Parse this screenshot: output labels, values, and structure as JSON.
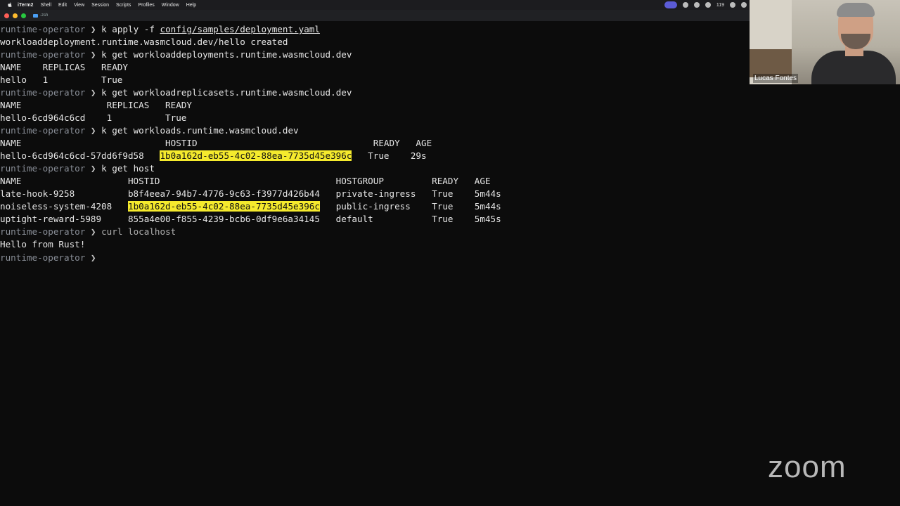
{
  "menubar": {
    "items": [
      "iTerm2",
      "Shell",
      "Edit",
      "View",
      "Session",
      "Scripts",
      "Profiles",
      "Window",
      "Help"
    ],
    "status_number": "119"
  },
  "tab": {
    "label": "-zsh"
  },
  "terminal": {
    "prompt": "runtime-operator",
    "lines": {
      "l1_cmd": "k apply -f ",
      "l1_path": "config/samples/deployment.yaml",
      "l2": "workloaddeployment.runtime.wasmcloud.dev/hello created",
      "l3_cmd": "k get workloaddeployments.runtime.wasmcloud.dev",
      "l4": "NAME    REPLICAS   READY",
      "l5": "hello   1          True",
      "l6_cmd": "k get workloadreplicasets.runtime.wasmcloud.dev",
      "l7": "NAME                REPLICAS   READY",
      "l8": "hello-6cd964c6cd    1          True",
      "l9_cmd": "k get workloads.runtime.wasmcloud.dev",
      "l10": "NAME                           HOSTID                                 READY   AGE",
      "l11_name": "hello-6cd964c6cd-57dd6f9d58   ",
      "l11_hostid": "1b0a162d-eb55-4c02-88ea-7735d45e396c",
      "l11_rest": "   True    29s",
      "l12_cmd": "k get host",
      "l13": "NAME                    HOSTID                                 HOSTGROUP         READY   AGE",
      "l14": "late-hook-9258          b8f4eea7-94b7-4776-9c63-f3977d426b44   private-ingress   True    5m44s",
      "l15_name": "noiseless-system-4208   ",
      "l15_hostid": "1b0a162d-eb55-4c02-88ea-7735d45e396c",
      "l15_rest": "   public-ingress    True    5m44s",
      "l16": "uptight-reward-5989     855a4e00-f855-4239-bcb6-0df9e6a34145   default           True    5m45s",
      "l17_cmd": "curl localhost",
      "l18": "Hello from Rust!"
    }
  },
  "webcam": {
    "participant_name": "Lucas Fontes"
  },
  "zoom": {
    "logo_text": "zoom"
  },
  "colors": {
    "highlight": "#f5ea2d",
    "background": "#0c0c0c",
    "prompt": "#8a8f98"
  }
}
